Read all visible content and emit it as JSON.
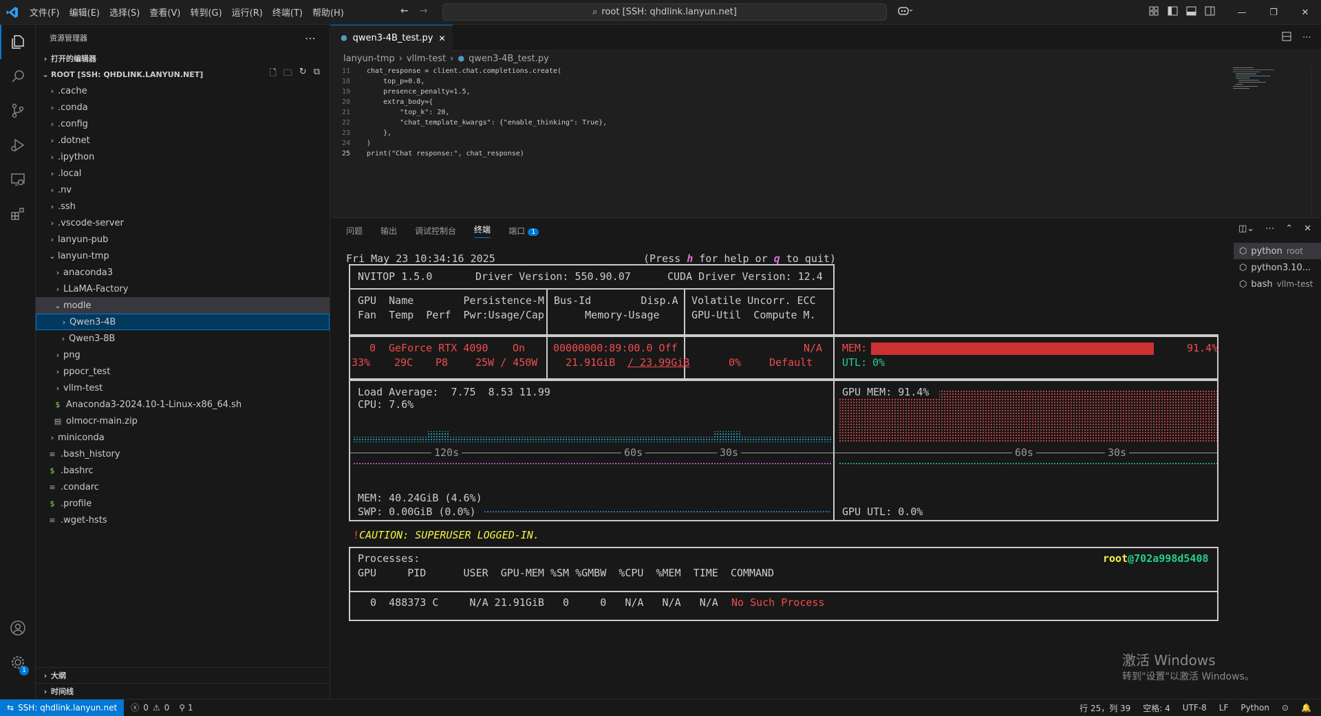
{
  "titlebar": {
    "menu": [
      "文件(F)",
      "编辑(E)",
      "选择(S)",
      "查看(V)",
      "转到(G)",
      "运行(R)",
      "终端(T)",
      "帮助(H)"
    ],
    "command_center": "root [SSH: qhdlink.lanyun.net]"
  },
  "sidebar": {
    "title": "资源管理器",
    "open_editors": "打开的编辑器",
    "root_label": "ROOT [SSH: QHDLINK.LANYUN.NET]",
    "tree": [
      {
        "label": ".cache",
        "depth": 1,
        "type": "folder"
      },
      {
        "label": ".conda",
        "depth": 1,
        "type": "folder"
      },
      {
        "label": ".config",
        "depth": 1,
        "type": "folder"
      },
      {
        "label": ".dotnet",
        "depth": 1,
        "type": "folder"
      },
      {
        "label": ".ipython",
        "depth": 1,
        "type": "folder"
      },
      {
        "label": ".local",
        "depth": 1,
        "type": "folder"
      },
      {
        "label": ".nv",
        "depth": 1,
        "type": "folder"
      },
      {
        "label": ".ssh",
        "depth": 1,
        "type": "folder"
      },
      {
        "label": ".vscode-server",
        "depth": 1,
        "type": "folder"
      },
      {
        "label": "lanyun-pub",
        "depth": 1,
        "type": "folder"
      },
      {
        "label": "lanyun-tmp",
        "depth": 1,
        "type": "folder-open"
      },
      {
        "label": "anaconda3",
        "depth": 2,
        "type": "folder"
      },
      {
        "label": "LLaMA-Factory",
        "depth": 2,
        "type": "folder"
      },
      {
        "label": "modle",
        "depth": 2,
        "type": "folder-open",
        "state": "hl"
      },
      {
        "label": "Qwen3-4B",
        "depth": 3,
        "type": "folder",
        "state": "sel"
      },
      {
        "label": "Qwen3-8B",
        "depth": 3,
        "type": "folder"
      },
      {
        "label": "png",
        "depth": 2,
        "type": "folder"
      },
      {
        "label": "ppocr_test",
        "depth": 2,
        "type": "folder"
      },
      {
        "label": "vllm-test",
        "depth": 2,
        "type": "folder"
      },
      {
        "label": "Anaconda3-2024.10-1-Linux-x86_64.sh",
        "depth": 2,
        "type": "sh"
      },
      {
        "label": "olmocr-main.zip",
        "depth": 2,
        "type": "zip"
      },
      {
        "label": "miniconda",
        "depth": 1,
        "type": "folder"
      },
      {
        "label": ".bash_history",
        "depth": 1,
        "type": "txt"
      },
      {
        "label": ".bashrc",
        "depth": 1,
        "type": "sh"
      },
      {
        "label": ".condarc",
        "depth": 1,
        "type": "txt"
      },
      {
        "label": ".profile",
        "depth": 1,
        "type": "sh"
      },
      {
        "label": ".wget-hsts",
        "depth": 1,
        "type": "txt"
      }
    ],
    "outline": "大纲",
    "timeline": "时间线"
  },
  "editor": {
    "tab": "qwen3-4B_test.py",
    "breadcrumb": [
      "lanyun-tmp",
      "vllm-test",
      "qwen3-4B_test.py"
    ],
    "lines": [
      {
        "n": "11",
        "t": "chat_response = client.chat.completions.create("
      },
      {
        "n": "18",
        "t": "    top_p=0.8,"
      },
      {
        "n": "19",
        "t": "    presence_penalty=1.5,"
      },
      {
        "n": "20",
        "t": "    extra_body={"
      },
      {
        "n": "21",
        "t": "        \"top_k\": 20,"
      },
      {
        "n": "22",
        "t": "        \"chat_template_kwargs\": {\"enable_thinking\": True},"
      },
      {
        "n": "23",
        "t": "    },"
      },
      {
        "n": "24",
        "t": ")"
      },
      {
        "n": "25",
        "t": "print(\"Chat response:\", chat_response)"
      }
    ]
  },
  "panel": {
    "tabs": [
      "问题",
      "输出",
      "调试控制台",
      "终端",
      "端口"
    ],
    "ports_badge": "1",
    "terminals": [
      {
        "name": "python",
        "sub": "root"
      },
      {
        "name": "python3.10...",
        "sub": ""
      },
      {
        "name": "bash",
        "sub": "vllm-test"
      }
    ]
  },
  "nvitop": {
    "datetime": "Fri May 23 10:34:16 2025",
    "help_text": "(Press h for help or q to quit)",
    "version": "NVITOP 1.5.0",
    "driver": "Driver Version: 550.90.07",
    "cuda": "CUDA Driver Version: 12.4",
    "hdr1a": "GPU  Name        Persistence-M",
    "hdr1b": "Fan  Temp  Perf  Pwr:Usage/Cap",
    "hdr2a": "Bus-Id        Disp.A",
    "hdr2b": "     Memory-Usage",
    "hdr3a": "Volatile Uncorr. ECC",
    "hdr3b": "GPU-Util  Compute M.",
    "gpu_idx": "0",
    "gpu_name": "GeForce RTX 4090",
    "persistence": "On",
    "fan": "33%",
    "temp": "29C",
    "perf": "P8",
    "power": "25W / 450W",
    "bus_id": "00000000:89:00.0 Off",
    "mem_used": "21.91GiB",
    "mem_total": "/ 23.99GiB",
    "ecc": "N/A",
    "gpu_util": "0%",
    "compute_mode": "Default",
    "mem_label": "MEM:",
    "mem_pct": "91.4%",
    "mem_fraction": 0.914,
    "utl_label": "UTL:",
    "utl_pct": "0%",
    "load_avg": "Load Average:  7.75  8.53 11.99",
    "cpu": "CPU: 7.6%",
    "gpu_mem_graph": "GPU MEM: 91.4%",
    "t120": "120s",
    "t60": "60s",
    "t30": "30s",
    "host_mem": "MEM: 40.24GiB (4.6%)",
    "swp": "SWP: 0.00GiB (0.0%)",
    "gpu_utl_graph": "GPU UTL: 0.0%",
    "caution_mark": "!",
    "caution": "CAUTION: SUPERUSER LOGGED-IN.",
    "processes": "Processes:",
    "user": "root",
    "host": "@702a998d5408",
    "proc_header": "GPU     PID      USER  GPU-MEM %SM %GMBW  %CPU  %MEM  TIME  COMMAND",
    "proc_row": "  0  488373 C     N/A 21.91GiB   0     0   N/A   N/A   N/A",
    "proc_cmd": "No Such Process"
  },
  "watermark": {
    "line1": "激活 Windows",
    "line2": "转到\"设置\"以激活 Windows。"
  },
  "statusbar": {
    "remote": "SSH: qhdlink.lanyun.net",
    "errors": "0",
    "warnings": "0",
    "ports": "1",
    "position": "行 25，列 39",
    "spaces": "空格: 4",
    "encoding": "UTF-8",
    "eol": "LF",
    "language": "Python"
  },
  "colors": {
    "accent": "#0078d4",
    "mem_bar": "#cd3131",
    "graph_cyan": "#29b8db",
    "graph_red": "#f14c4c",
    "graph_magenta": "#d670d6",
    "graph_green": "#23d18b"
  }
}
